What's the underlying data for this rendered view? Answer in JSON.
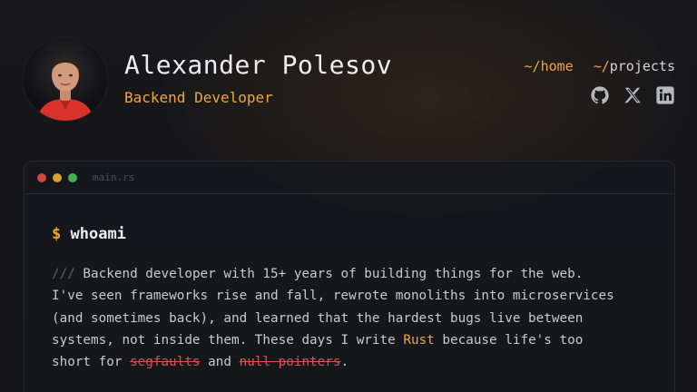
{
  "profile": {
    "name": "Alexander Polesov",
    "role": "Backend Developer"
  },
  "nav": {
    "items": [
      {
        "prefix": "~/",
        "label": "home"
      },
      {
        "prefix": "~/",
        "label": "projects"
      }
    ]
  },
  "socials": [
    "github-icon",
    "x-icon",
    "linkedin-icon"
  ],
  "window": {
    "filename": "main.rs",
    "command_symbol": "$",
    "command": "whoami",
    "bio": {
      "comment_marker": "///",
      "line1": " Backend developer with 15+ years of building things for the web.",
      "line2": "I've seen frameworks rise and fall, rewrote monoliths into microservices",
      "line3": "(and sometimes back), and learned that the hardest bugs live between",
      "line4_before": "systems, not inside them. These days I write ",
      "line4_highlight": "Rust",
      "line4_after": " because life's too",
      "line5_before": "short for ",
      "strike1": "segfaults",
      "line5_mid": " and ",
      "strike2": "null pointers",
      "line5_after": "."
    }
  },
  "colors": {
    "accent": "#f0a63a",
    "strike": "#d65353",
    "comment": "#5d616b",
    "dot_red": "#d44545",
    "dot_yellow": "#d7a22e",
    "dot_green": "#3fb34f"
  }
}
